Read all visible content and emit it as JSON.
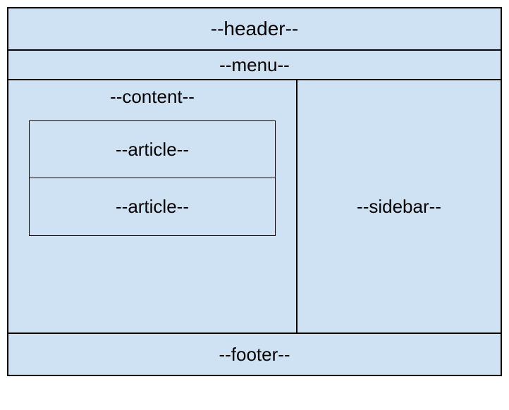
{
  "header": {
    "label": "--header--"
  },
  "menu": {
    "label": "--menu--"
  },
  "content": {
    "label": "--content--",
    "articles": [
      {
        "label": "--article--"
      },
      {
        "label": "--article--"
      }
    ]
  },
  "sidebar": {
    "label": "--sidebar--"
  },
  "footer": {
    "label": "--footer--"
  }
}
